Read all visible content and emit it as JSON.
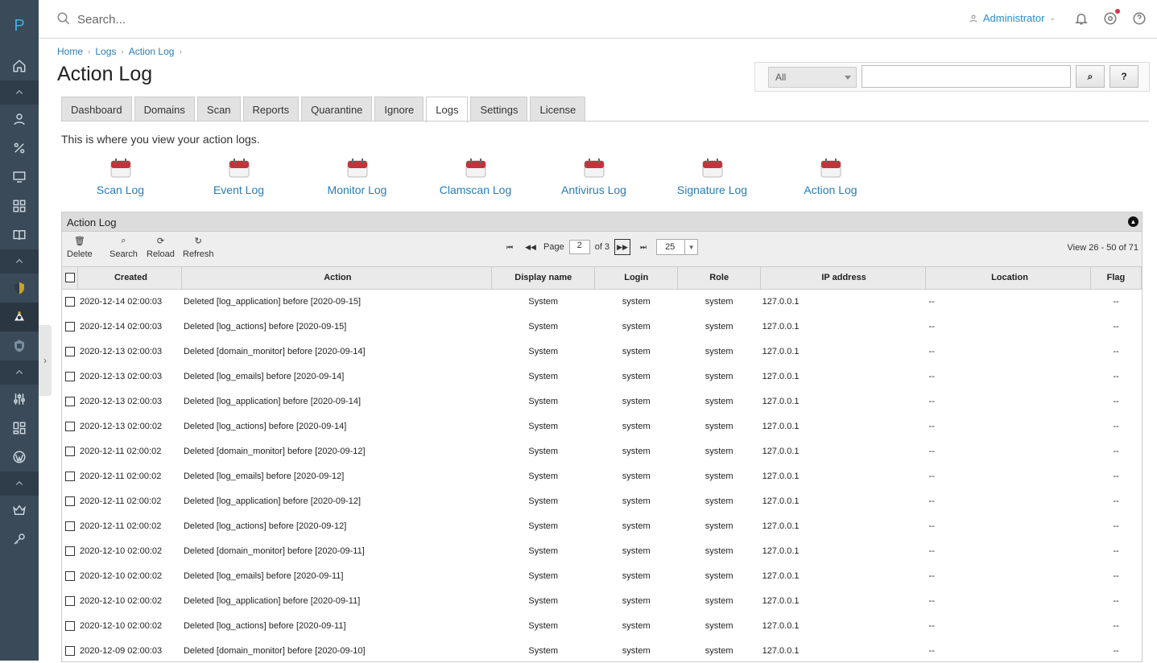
{
  "app": {
    "logo_letter": "P"
  },
  "topbar": {
    "search_placeholder": "Search...",
    "user_name": "Administrator"
  },
  "breadcrumb": [
    "Home",
    "Logs",
    "Action Log"
  ],
  "page_title": "Action Log",
  "filter": {
    "select_value": "All",
    "search_button": "⌕",
    "help_button": "?"
  },
  "tabs": [
    {
      "label": "Dashboard"
    },
    {
      "label": "Domains"
    },
    {
      "label": "Scan"
    },
    {
      "label": "Reports"
    },
    {
      "label": "Quarantine"
    },
    {
      "label": "Ignore"
    },
    {
      "label": "Logs",
      "active": true
    },
    {
      "label": "Settings"
    },
    {
      "label": "License"
    }
  ],
  "intro_text": "This is where you view your action logs.",
  "log_links": [
    "Scan Log",
    "Event Log",
    "Monitor Log",
    "Clamscan Log",
    "Antivirus Log",
    "Signature Log",
    "Action Log"
  ],
  "grid": {
    "title": "Action Log",
    "tools": [
      "Delete",
      "Search",
      "Reload",
      "Refresh"
    ],
    "pager": {
      "page_label": "Page",
      "page": "2",
      "of_label": "of 3",
      "page_size": "25"
    },
    "view_count": "View 26 - 50 of 71",
    "columns": [
      "Created",
      "Action",
      "Display name",
      "Login",
      "Role",
      "IP address",
      "Location",
      "Flag"
    ],
    "rows": [
      [
        "2020-12-14 02:00:03",
        "Deleted [log_application] before [2020-09-15]",
        "System",
        "system",
        "system",
        "127.0.0.1",
        "--",
        "--"
      ],
      [
        "2020-12-14 02:00:03",
        "Deleted [log_actions] before [2020-09-15]",
        "System",
        "system",
        "system",
        "127.0.0.1",
        "--",
        "--"
      ],
      [
        "2020-12-13 02:00:03",
        "Deleted [domain_monitor] before [2020-09-14]",
        "System",
        "system",
        "system",
        "127.0.0.1",
        "--",
        "--"
      ],
      [
        "2020-12-13 02:00:03",
        "Deleted [log_emails] before [2020-09-14]",
        "System",
        "system",
        "system",
        "127.0.0.1",
        "--",
        "--"
      ],
      [
        "2020-12-13 02:00:03",
        "Deleted [log_application] before [2020-09-14]",
        "System",
        "system",
        "system",
        "127.0.0.1",
        "--",
        "--"
      ],
      [
        "2020-12-13 02:00:02",
        "Deleted [log_actions] before [2020-09-14]",
        "System",
        "system",
        "system",
        "127.0.0.1",
        "--",
        "--"
      ],
      [
        "2020-12-11 02:00:02",
        "Deleted [domain_monitor] before [2020-09-12]",
        "System",
        "system",
        "system",
        "127.0.0.1",
        "--",
        "--"
      ],
      [
        "2020-12-11 02:00:02",
        "Deleted [log_emails] before [2020-09-12]",
        "System",
        "system",
        "system",
        "127.0.0.1",
        "--",
        "--"
      ],
      [
        "2020-12-11 02:00:02",
        "Deleted [log_application] before [2020-09-12]",
        "System",
        "system",
        "system",
        "127.0.0.1",
        "--",
        "--"
      ],
      [
        "2020-12-11 02:00:02",
        "Deleted [log_actions] before [2020-09-12]",
        "System",
        "system",
        "system",
        "127.0.0.1",
        "--",
        "--"
      ],
      [
        "2020-12-10 02:00:02",
        "Deleted [domain_monitor] before [2020-09-11]",
        "System",
        "system",
        "system",
        "127.0.0.1",
        "--",
        "--"
      ],
      [
        "2020-12-10 02:00:02",
        "Deleted [log_emails] before [2020-09-11]",
        "System",
        "system",
        "system",
        "127.0.0.1",
        "--",
        "--"
      ],
      [
        "2020-12-10 02:00:02",
        "Deleted [log_application] before [2020-09-11]",
        "System",
        "system",
        "system",
        "127.0.0.1",
        "--",
        "--"
      ],
      [
        "2020-12-10 02:00:02",
        "Deleted [log_actions] before [2020-09-11]",
        "System",
        "system",
        "system",
        "127.0.0.1",
        "--",
        "--"
      ],
      [
        "2020-12-09 02:00:03",
        "Deleted [domain_monitor] before [2020-09-10]",
        "System",
        "system",
        "system",
        "127.0.0.1",
        "--",
        "--"
      ]
    ]
  },
  "colors": {
    "rail_bg": "#3b4a58",
    "link": "#2a7cb8",
    "accent": "#2a8cc8",
    "notify_dot": "#d9324a"
  }
}
